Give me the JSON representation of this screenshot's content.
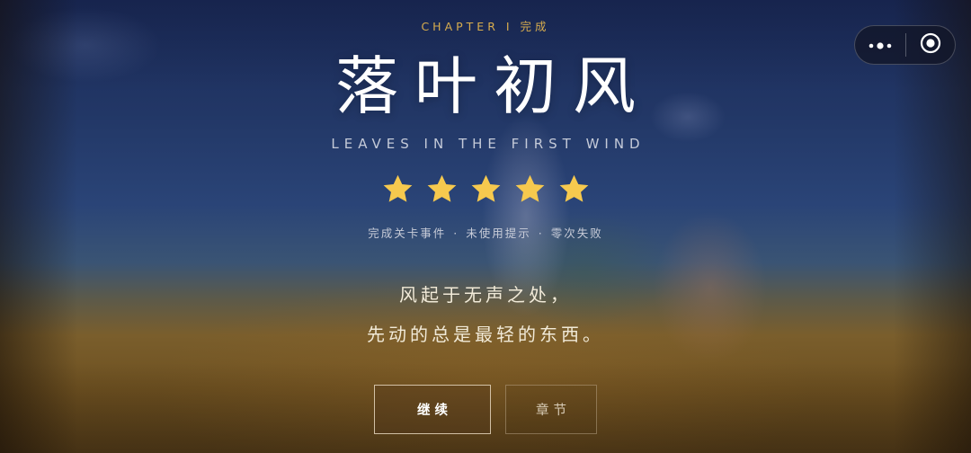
{
  "header": {
    "chapter_label": "CHAPTER Ⅰ 完成"
  },
  "level": {
    "title": "落叶初风",
    "subtitle": "LEAVES IN THE FIRST WIND"
  },
  "rating": {
    "stars_earned": 5,
    "stars_total": 5,
    "star_color": "#f6c94e"
  },
  "achievements": {
    "items": [
      "完成关卡事件",
      "未使用提示",
      "零次失败"
    ],
    "separator": "·"
  },
  "poem": {
    "line1": "风起于无声之处，",
    "line2": "先动的总是最轻的东西。"
  },
  "buttons": {
    "continue_label": "继续",
    "chapters_label": "章节"
  },
  "capsule": {
    "more_icon": "more-dots-icon",
    "close_icon": "target-close-icon"
  },
  "colors": {
    "accent_gold": "#d8ad4e",
    "sky_top": "#1b2b5a",
    "ground": "#7a5e2c"
  }
}
